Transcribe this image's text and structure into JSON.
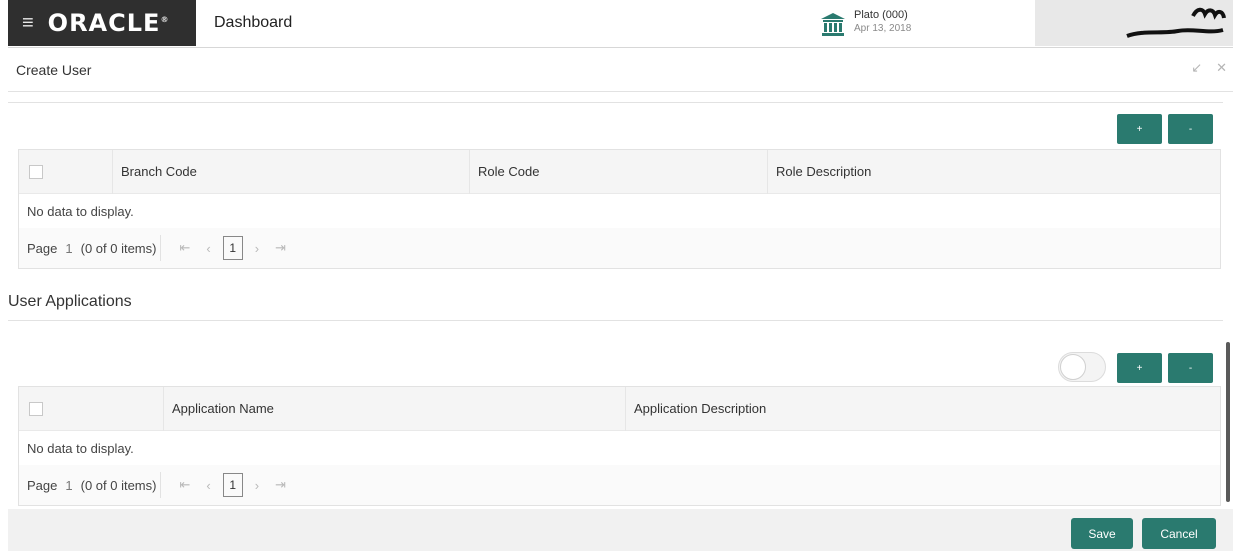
{
  "header": {
    "brand": "ORACLE",
    "brand_mark": "®",
    "title": "Dashboard",
    "bank_name": "Plato (000)",
    "bank_date": "Apr 13, 2018"
  },
  "modal": {
    "title": "Create User"
  },
  "roles": {
    "add_label": "+",
    "remove_label": "-",
    "columns": [
      "Branch Code",
      "Role Code",
      "Role Description"
    ],
    "empty_text": "No data to display.",
    "pager": {
      "label": "Page",
      "page": "1",
      "summary": "(0 of 0 items)",
      "current": "1"
    }
  },
  "applications": {
    "section_title": "User Applications",
    "add_label": "+",
    "remove_label": "-",
    "columns": [
      "Application Name",
      "Application Description"
    ],
    "empty_text": "No data to display.",
    "pager": {
      "label": "Page",
      "page": "1",
      "summary": "(0 of 0 items)",
      "current": "1"
    }
  },
  "footer": {
    "save_label": "Save",
    "cancel_label": "Cancel"
  },
  "colors": {
    "accent": "#2a7a6f",
    "brand_bg": "#2f2f2f",
    "bank_icon": "#2a7a6f"
  }
}
